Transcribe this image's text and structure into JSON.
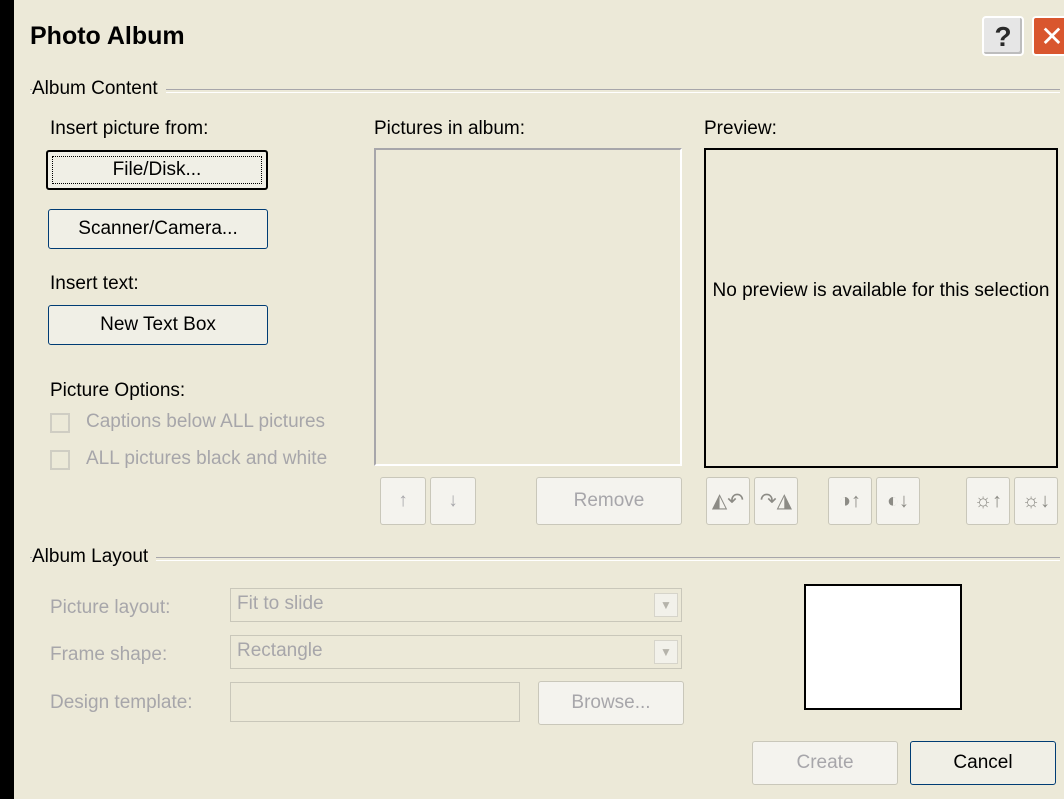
{
  "window": {
    "title": "Photo Album",
    "help_glyph": "?",
    "close_glyph": "✕"
  },
  "album_content": {
    "group_label": "Album Content",
    "insert_picture_label": "Insert picture from:",
    "file_disk_button": "File/Disk...",
    "scanner_camera_button": "Scanner/Camera...",
    "insert_text_label": "Insert text:",
    "new_text_box_button": "New Text Box",
    "picture_options_label": "Picture Options:",
    "captions_option": "Captions below ALL pictures",
    "black_white_option": "ALL pictures black and white",
    "pictures_in_album_label": "Pictures in album:",
    "preview_label": "Preview:",
    "preview_message": "No preview is available for this selection",
    "move_up_glyph": "↑",
    "move_down_glyph": "↓",
    "remove_button": "Remove",
    "image_tools": [
      {
        "name": "rotate-left-icon",
        "glyph": "◭↶"
      },
      {
        "name": "rotate-right-icon",
        "glyph": "↷◮"
      },
      {
        "name": "more-contrast-icon",
        "glyph": "◑↑"
      },
      {
        "name": "less-contrast-icon",
        "glyph": "◐↓"
      },
      {
        "name": "more-brightness-icon",
        "glyph": "☼↑"
      },
      {
        "name": "less-brightness-icon",
        "glyph": "☼↓"
      }
    ]
  },
  "album_layout": {
    "group_label": "Album Layout",
    "picture_layout_label": "Picture layout:",
    "picture_layout_value": "Fit to slide",
    "frame_shape_label": "Frame shape:",
    "frame_shape_value": "Rectangle",
    "design_template_label": "Design template:",
    "design_template_value": "",
    "browse_button": "Browse..."
  },
  "footer": {
    "create_button": "Create",
    "cancel_button": "Cancel"
  }
}
